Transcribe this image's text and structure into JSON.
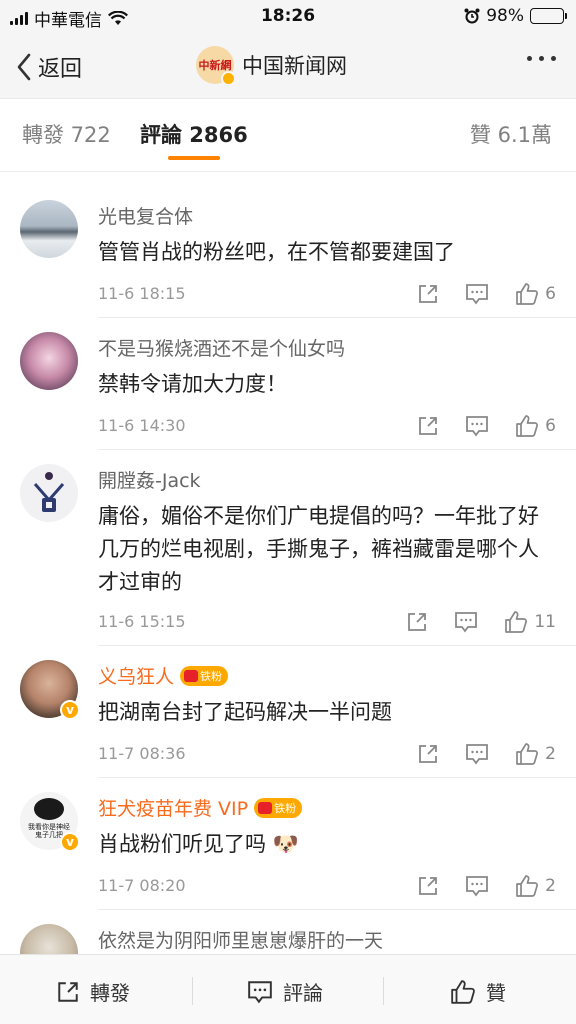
{
  "status": {
    "carrier": "中華電信",
    "time": "18:26",
    "battery": "98%",
    "battery_level": 0.98
  },
  "nav": {
    "back_label": "返回",
    "account_name": "中国新闻网",
    "avatar_text": "中新網"
  },
  "tabs": [
    {
      "label": "轉發 722"
    },
    {
      "label": "評論 2866"
    },
    {
      "label": "贊 6.1萬"
    }
  ],
  "comments": [
    {
      "user": "光电复合体",
      "text": "管管肖战的粉丝吧，在不管都要建国了",
      "time": "11-6 18:15",
      "likes": "6"
    },
    {
      "user": "不是马猴烧酒还不是个仙女吗",
      "text": "禁韩令请加大力度！",
      "time": "11-6 14:30",
      "likes": "6"
    },
    {
      "user": "開膛姦-Jack",
      "text": "庸俗，媚俗不是你们广电提倡的吗？一年批了好几万的烂电视剧，手撕鬼子，裤裆藏雷是哪个人才过审的",
      "time": "11-6 15:15",
      "likes": "11"
    },
    {
      "user": "义乌狂人",
      "badge": "铁粉",
      "text": "把湖南台封了起码解决一半问题",
      "time": "11-7 08:36",
      "likes": "2"
    },
    {
      "user": "狂犬疫苗年费 VIP",
      "badge": "铁粉",
      "text": "肖战粉们听见了吗 🐶",
      "time": "11-7 08:20",
      "likes": "2",
      "avatar_caption": "我看你是神经\n鬼子几把"
    },
    {
      "user": "依然是为阴阳师里崽崽爆肝的一天"
    }
  ],
  "bottom": {
    "repost": "轉發",
    "comment": "評論",
    "like": "贊"
  },
  "colors": {
    "accent": "#ff8200",
    "vip_name": "#f86b1d",
    "badge": "#ffa800"
  }
}
